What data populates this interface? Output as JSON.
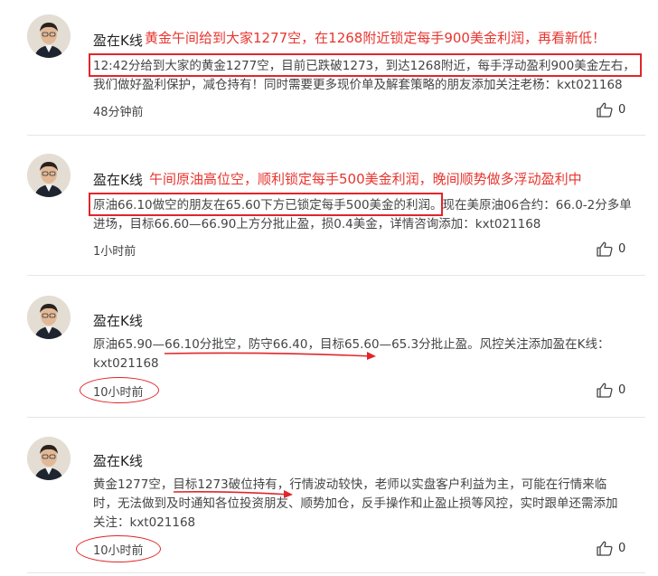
{
  "posts": [
    {
      "author": "盈在K线",
      "headline": "黄金午间给到大家1277空，在1268附近锁定每手900美金利润，再看新低！",
      "body_lines": [
        "12:42分给到大家的黄金1277空，目前已跌破1273，到达1268附近，每手浮动盈利900美金左右，",
        "我们做好盈利保护，减仓持有！同时需要更多现价单及解套策略的朋友添加关注老杨：kxt021168"
      ],
      "time": "48分钟前",
      "likes": "0"
    },
    {
      "author": "盈在K线",
      "headline": "午间原油高位空，顺利锁定每手500美金利润，晚间顺势做多浮动盈利中",
      "body_lines": [
        "原油66.10做空的朋友在65.60下方已锁定每手500美金的利润。现在美原油06合约：66.0-2分多单",
        "进场，目标66.60—66.90上方分批止盈，损0.4美金，详情咨询添加：kxt021168"
      ],
      "time": "1小时前",
      "likes": "0"
    },
    {
      "author": "盈在K线",
      "headline": "",
      "body_lines": [
        "原油65.90—66.10分批空，防守66.40，目标65.60—65.3分批止盈。风控关注添加盈在K线：",
        "kxt021168"
      ],
      "time": "10小时前",
      "likes": "0"
    },
    {
      "author": "盈在K线",
      "headline": "",
      "body_lines": [
        "黄金1277空，目标1273破位持有，行情波动较快，老师以实盘客户利益为主，可能在行情来临",
        "时，无法做到及时通知各位投资朋友、顺势加仓，反手操作和止盈止损等风控，实时跟单还需添加",
        "关注：kxt021168"
      ],
      "time": "10小时前",
      "likes": "0"
    }
  ],
  "icons": {
    "like": "thumbs-up-icon",
    "avatar": "avatar-portrait"
  },
  "colors": {
    "headline": "#e8352f",
    "annotation": "#e0262b"
  }
}
